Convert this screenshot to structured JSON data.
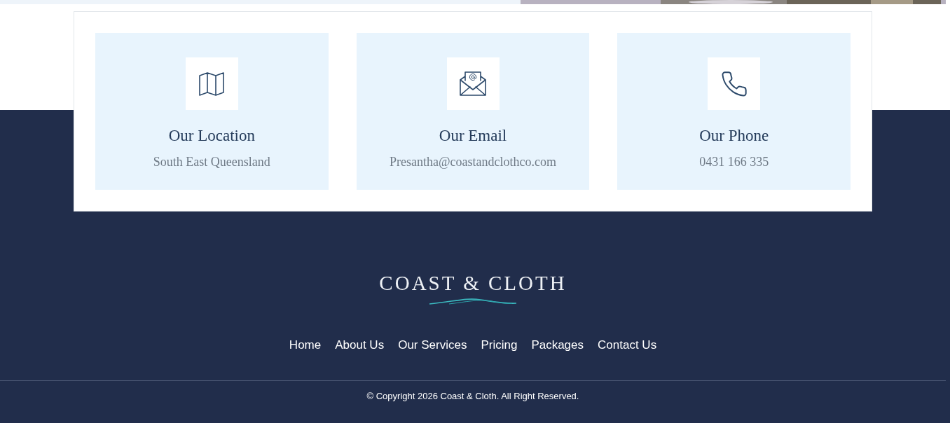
{
  "contact_cards": [
    {
      "kind": "map",
      "title": "Our Location",
      "detail": "South East Queensland"
    },
    {
      "kind": "email",
      "title": "Our Email",
      "detail": "Presantha@coastandclothco.com"
    },
    {
      "kind": "phone",
      "title": "Our Phone",
      "detail": "0431 166 335"
    }
  ],
  "footer": {
    "logo": "COAST & CLOTH",
    "nav": [
      "Home",
      "About Us",
      "Our Services",
      "Pricing",
      "Packages",
      "Contact Us"
    ],
    "copyright": "© Copyright 2026 Coast & Cloth. All Right Reserved."
  }
}
